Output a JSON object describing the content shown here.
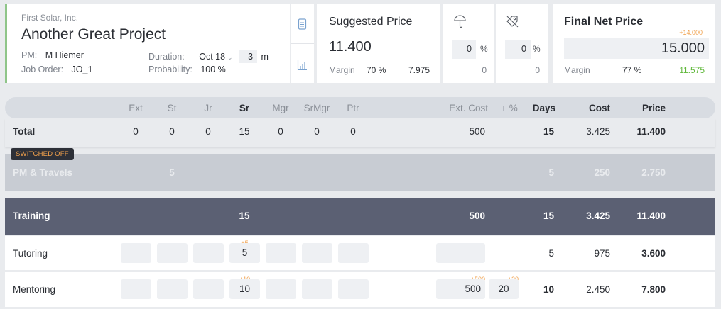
{
  "project": {
    "client": "First Solar, Inc.",
    "title": "Another Great Project",
    "pm_label": "PM:",
    "pm_value": "M Hiemer",
    "job_label": "Job Order:",
    "job_value": "JO_1",
    "duration_label": "Duration:",
    "duration_start": "Oct 18",
    "duration_value": "3",
    "duration_unit": "m",
    "probability_label": "Probability:",
    "probability_value": "100 %"
  },
  "icons": {
    "top": "document-icon",
    "bottom": "chart-icon"
  },
  "suggested": {
    "heading": "Suggested Price",
    "price": "11.400",
    "margin_label": "Margin",
    "margin_pct": "70 %",
    "margin_value": "7.975"
  },
  "discount1": {
    "icon": "umbrella-icon",
    "value": "0",
    "unit": "%",
    "result": "0"
  },
  "discount2": {
    "icon": "tag-off-icon",
    "value": "0",
    "unit": "%",
    "result": "0"
  },
  "final": {
    "heading": "Final Net Price",
    "delta": "+14.000",
    "price": "15.000",
    "margin_label": "Margin",
    "margin_pct": "77 %",
    "margin_value": "11.575",
    "margin_value_color": "#5fb83a"
  },
  "table": {
    "headers": {
      "ext": "Ext",
      "st": "St",
      "jr": "Jr",
      "sr": "Sr",
      "mgr": "Mgr",
      "srmgr": "SrMgr",
      "ptr": "Ptr",
      "extcost": "Ext. Cost",
      "plus": "+ %",
      "days": "Days",
      "cost": "Cost",
      "price": "Price"
    },
    "total": {
      "label": "Total",
      "ext": "0",
      "st": "0",
      "jr": "0",
      "sr": "15",
      "mgr": "0",
      "srmgr": "0",
      "ptr": "0",
      "extcost": "500",
      "days": "15",
      "cost": "3.425",
      "price": "11.400"
    },
    "switched_badge": "SWITCHED OFF",
    "pm": {
      "label": "PM & Travels",
      "st": "5",
      "days": "5",
      "cost": "250",
      "price": "2.750"
    },
    "training": {
      "label": "Training",
      "sr": "15",
      "extcost": "500",
      "days": "15",
      "cost": "3.425",
      "price": "11.400"
    },
    "tutoring": {
      "label": "Tutoring",
      "sr_delta": "+5",
      "sr": "5",
      "days": "5",
      "cost": "975",
      "price": "3.600"
    },
    "mentoring": {
      "label": "Mentoring",
      "sr_delta": "+10",
      "sr": "10",
      "extcost_delta": "+500",
      "extcost": "500",
      "plus_delta": "+20",
      "plus": "20",
      "days": "10",
      "cost": "2.450",
      "price": "7.800"
    }
  },
  "colors": {
    "accent": "#8fc589",
    "orange": "#f0a04b",
    "training_bg": "#5b6073",
    "header_band": "#d8dce2"
  }
}
